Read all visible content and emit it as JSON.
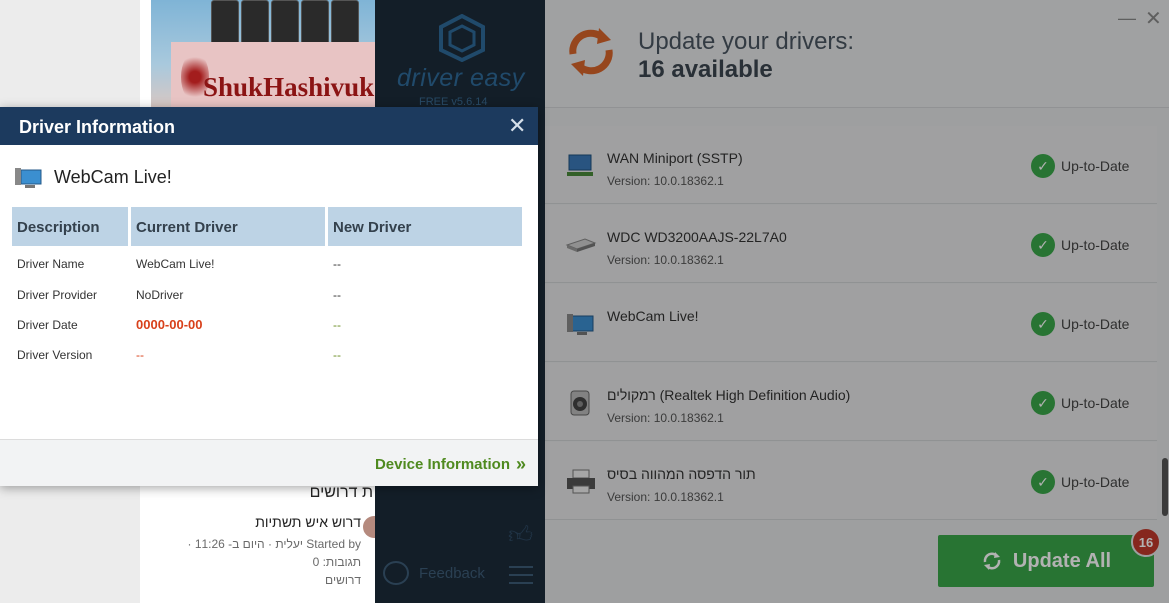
{
  "background_page": {
    "ad_brand": "ShukHashivuk",
    "forum_header": "ת דרושים",
    "forum_title": "דרוש איש תשתיות",
    "forum_started_by": "Started by יעלית · היום ב- 11:26 ·",
    "forum_replies": "תגובות: 0",
    "forum_category": "דרושים"
  },
  "driver_easy": {
    "logo_text": "driver easy",
    "version": "FREE v5.6.14",
    "header_line1": "Update your drivers:",
    "header_line2": "16 available",
    "feedback_label": "Feedback",
    "devices": [
      {
        "name": "WAN Miniport (SSTP)",
        "version": "Version: 10.0.18362.1",
        "status": "Up-to-Date",
        "icon": "network-adapter-icon"
      },
      {
        "name": "WDC WD3200AAJS-22L7A0",
        "version": "Version: 10.0.18362.1",
        "status": "Up-to-Date",
        "icon": "hard-drive-icon"
      },
      {
        "name": "WebCam Live!",
        "version": "",
        "status": "Up-to-Date",
        "icon": "webcam-monitor-icon"
      },
      {
        "name": "רמקולים (Realtek High Definition Audio)",
        "version": "Version: 10.0.18362.1",
        "status": "Up-to-Date",
        "icon": "speaker-icon"
      },
      {
        "name": "תור הדפסה המהווה בסיס",
        "version": "Version: 10.0.18362.1",
        "status": "Up-to-Date",
        "icon": "printer-icon"
      }
    ],
    "update_all_label": "Update All",
    "update_count_badge": "16"
  },
  "dialog": {
    "title": "Driver Information",
    "device_name": "WebCam Live!",
    "columns": [
      "Description",
      "Current Driver",
      "New Driver"
    ],
    "rows": [
      {
        "description": "Driver Name",
        "current": "WebCam Live!",
        "new": "--"
      },
      {
        "description": "Driver Provider",
        "current": "NoDriver",
        "new": "--"
      },
      {
        "description": "Driver Date",
        "current": "0000-00-00",
        "new": "--"
      },
      {
        "description": "Driver Version",
        "current": "--",
        "new": "--"
      }
    ],
    "device_info_link": "Device Information"
  },
  "colors": {
    "accent_green": "#3aa64a",
    "title_bar": "#1c3a5e",
    "warning_red": "#d8401a",
    "badge_red": "#c0392b"
  }
}
